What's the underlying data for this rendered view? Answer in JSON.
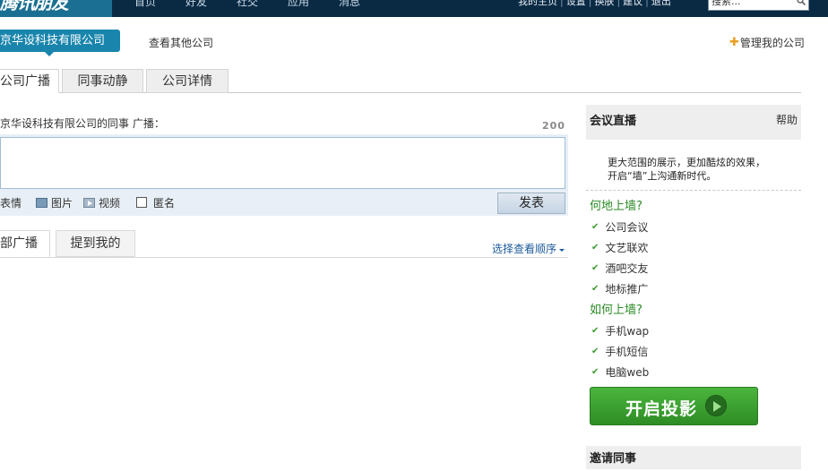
{
  "topbar": {
    "logo_text": "腾讯朋友",
    "nav": [
      "首页",
      "好友",
      "社交",
      "应用",
      "消息"
    ],
    "links": [
      "我的主页",
      "设置",
      "换肤",
      "建议",
      "退出"
    ],
    "search_placeholder": "搜索..."
  },
  "company": {
    "name": "京华设科技有限公司",
    "other_link": "查看其他公司",
    "manage_link": "管理我的公司"
  },
  "main_tabs": [
    "公司广播",
    "同事动静",
    "公司详情"
  ],
  "composer": {
    "label": "京华设科技有限公司的同事 广播：",
    "counter": "200",
    "tools": [
      "表情",
      "图片",
      "视频"
    ],
    "anonymous_label": "匿名",
    "publish_label": "发表"
  },
  "feed": {
    "tabs": [
      "部广播",
      "提到我的"
    ],
    "sort_label": "选择查看顺序"
  },
  "sidebar": {
    "title": "会议直播",
    "help": "帮助",
    "desc_line1": "更大范围的展示，更加酷炫的效果，",
    "desc_line2": "开启“墙”上沟通新时代。",
    "where_title": "何地上墙?",
    "where_items": [
      "公司会议",
      "文艺联欢",
      "酒吧交友",
      "地标推广"
    ],
    "how_title": "如何上墙?",
    "how_items": [
      "手机wap",
      "手机短信",
      "电脑web"
    ],
    "launch_label": "开启投影",
    "invite_title": "邀请同事"
  },
  "colors": {
    "topbar": "#0a2a44",
    "company_tag": "#1985ad",
    "accent_green": "#2e8d25"
  }
}
